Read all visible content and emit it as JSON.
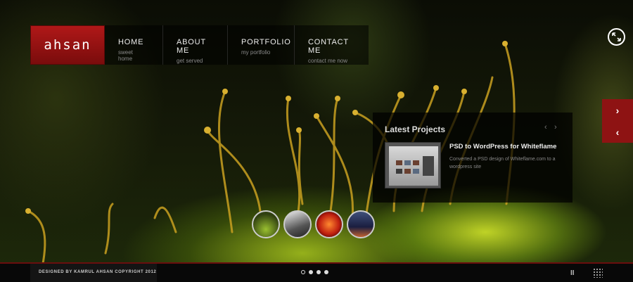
{
  "brand": {
    "logo": "ahsan"
  },
  "nav": [
    {
      "title": "HOME",
      "sub": "sweet home"
    },
    {
      "title": "ABOUT ME",
      "sub": "get served"
    },
    {
      "title": "PORTFOLIO",
      "sub": "my portfolio"
    },
    {
      "title": "CONTACT ME",
      "sub": "contact me now"
    }
  ],
  "icons": {
    "fullscreen": "fullscreen-icon",
    "next": "chevron-right-icon",
    "prev": "chevron-left-icon",
    "pause": "pause-icon",
    "grid": "grid-icon"
  },
  "glyphs": {
    "next": "›",
    "prev": "‹",
    "small_prev": "‹",
    "small_next": "›",
    "pause": "II"
  },
  "latest_projects": {
    "title": "Latest Projects",
    "item": {
      "name": "PSD to WordPress for Whiteflame",
      "desc": "Converted a PSD design of Whiteflame.com to a wordpress site"
    }
  },
  "slides": {
    "count": 4,
    "active_index": 0
  },
  "footer": {
    "credit": "DESIGNED BY KAMRUL AHSAN COPYRIGHT 2012"
  },
  "colors": {
    "accent": "#8e1313",
    "logo": "#b01818"
  }
}
